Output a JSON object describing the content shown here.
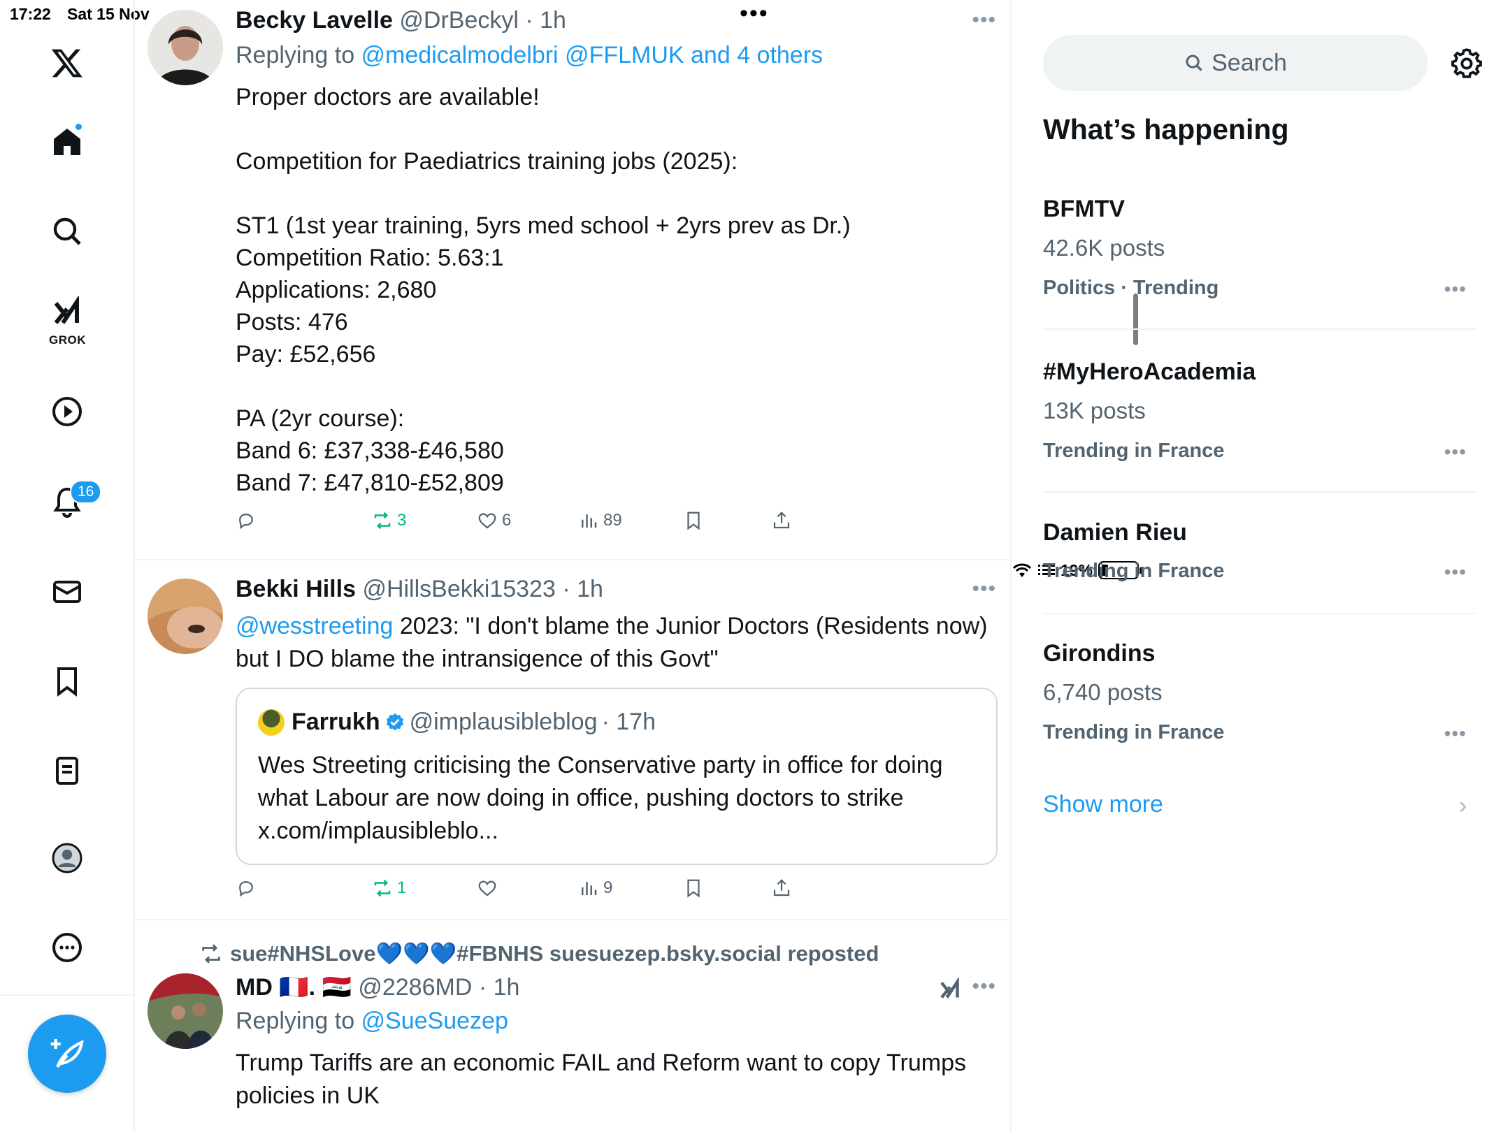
{
  "status_bar": {
    "time": "17:22",
    "date": "Sat 15 Nov",
    "battery": "19%"
  },
  "nav": {
    "items": [
      "x-logo",
      "home",
      "explore",
      "grok",
      "videos",
      "notifications",
      "messages",
      "bookmarks",
      "lists",
      "profile",
      "more"
    ],
    "grok_label": "GROK",
    "notification_count": "16",
    "accent_color": "#1d9bf0"
  },
  "tweets": [
    {
      "name": "Becky Lavelle",
      "handle": "@DrBeckyl",
      "time": "· 1h",
      "replying_prefix": "Replying to ",
      "replying_links": "@medicalmodelbri @FFLMUK and 4 others",
      "body": [
        "Proper doctors are available!",
        "",
        "Competition for Paediatrics training jobs (2025):",
        "",
        "ST1 (1st year training, 5yrs med school + 2yrs prev as Dr.)",
        "Competition Ratio: 5.63:1",
        "Applications: 2,680",
        "Posts: 476",
        "Pay: £52,656",
        "",
        "PA (2yr course):",
        "Band 6: £37,338-£46,580",
        "Band 7: £47,810-£52,809"
      ],
      "reposts": "3",
      "likes": "6",
      "views": "89"
    },
    {
      "name": "Bekki Hills",
      "handle": "@HillsBekki15323",
      "time": "· 1h",
      "mention": "@wesstreeting",
      "body_rest": " 2023: \"I don't blame the Junior Doctors (Residents now) but I DO blame the intransigence of this Govt\"",
      "quote": {
        "name": "Farrukh",
        "handle": "@implausibleblog",
        "time": "· 17h",
        "body": "Wes Streeting criticising the Conservative party in office for doing what Labour are now doing in office, pushing doctors to strike x.com/implausibleblo..."
      },
      "reposts": "1",
      "likes": "",
      "views": "9"
    },
    {
      "repost_by": "sue#NHSLove💙💙💙#FBNHS suesuezep.bsky.social reposted",
      "name": "MD 🇫🇷. 🇮🇶",
      "handle": "@2286MD",
      "time": "· 1h",
      "replying_prefix": "Replying to ",
      "replying_links": "@SueSuezep",
      "body": "Trump Tariffs are an economic FAIL and Reform want to copy Trumps policies in UK"
    }
  ],
  "sidebar": {
    "search_placeholder": "Search",
    "title": "What’s happening",
    "trends": [
      {
        "name": "BFMTV",
        "posts": "42.6K posts",
        "meta": "Politics · Trending"
      },
      {
        "name": "#MyHeroAcademia",
        "posts": "13K posts",
        "meta": "Trending in France"
      },
      {
        "name": "Damien Rieu",
        "posts": "",
        "meta": "Trending in France"
      },
      {
        "name": "Girondins",
        "posts": "6,740 posts",
        "meta": "Trending in France"
      }
    ],
    "show_more": "Show more"
  }
}
